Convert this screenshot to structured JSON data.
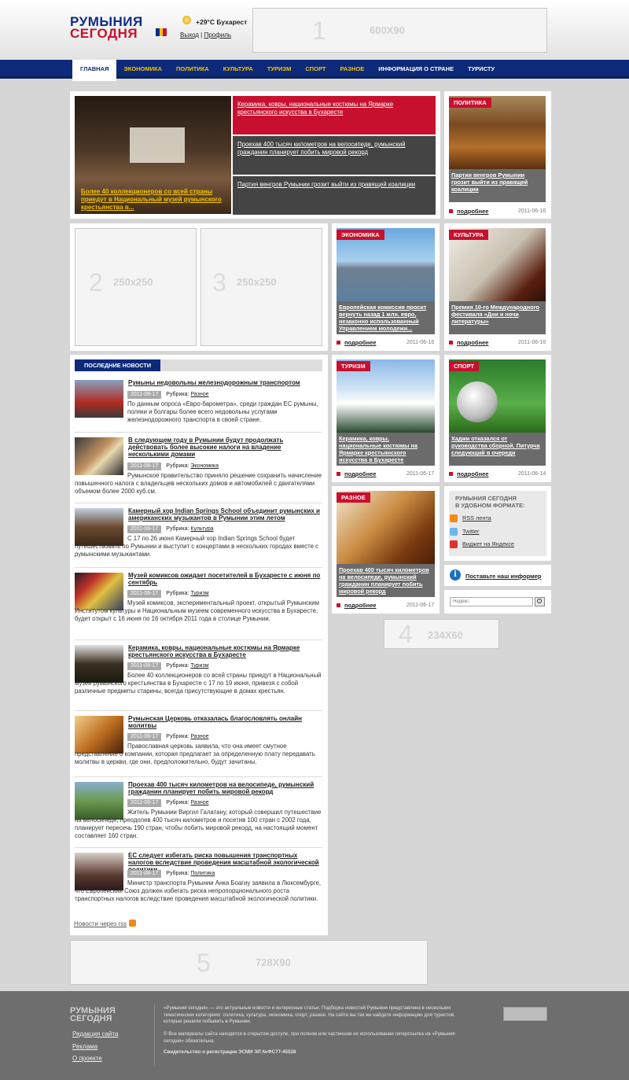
{
  "header": {
    "logo_line1": "РУМЫНИЯ",
    "logo_line2": "СЕГОДНЯ",
    "weather": "+29°C Бухарест",
    "logout": "Выход",
    "auth_sep": "|",
    "profile": "Профиль"
  },
  "banners": {
    "b1": {
      "num": "1",
      "size": "600X90"
    },
    "b2": {
      "num": "2",
      "size": "250x250"
    },
    "b3": {
      "num": "3",
      "size": "250x250"
    },
    "b4": {
      "num": "4",
      "size": "234X60"
    },
    "b5": {
      "num": "5",
      "size": "728X90"
    }
  },
  "nav": [
    "ГЛАВНАЯ",
    "ЭКОНОМИКА",
    "ПОЛИТИКА",
    "КУЛЬТУРА",
    "ТУРИЗМ",
    "СПОРТ",
    "РАЗНОЕ",
    "ИНФОРМАЦИЯ О СТРАНЕ",
    "ТУРИСТУ"
  ],
  "slider": {
    "caption": "Более 40 коллекционеров со всей страны приедут в Национальный музей румынского крестьянства в...",
    "headlines": [
      "Керамика, ковры, национальные костюмы на Ярмарке крестьянского искусства в Бухаресте",
      "Проехав 400 тысяч километров на велосипеде, румынский гражданин планирует побить мировой рекорд",
      "Партия венгров Румынии грозит выйти из правящей коалиции"
    ]
  },
  "cards": [
    {
      "tag": "ПОЛИТИКА",
      "title": "Партия венгров Румынии грозит выйти из правящей коалиции",
      "more": "подробнее",
      "date": "2011-06-16"
    },
    {
      "tag": "ЭКОНОМИКА",
      "title": "Европейская комиссия просит вернуть назад 1 млн. евро, незаконно использованный Управлением молодежи...",
      "more": "подробнее",
      "date": "2011-06-16"
    },
    {
      "tag": "КУЛЬТУРА",
      "title": "Премия 10-го Международного фестиваля «Дни и ночи литературы»",
      "more": "подробнее",
      "date": "2011-06-16"
    },
    {
      "tag": "ТУРИЗМ",
      "title": "Керамика, ковры, национальные костюмы на Ярмарке крестьянского искусства в Бухаресте",
      "more": "подробнее",
      "date": "2011-06-17"
    },
    {
      "tag": "СПОРТ",
      "title": "Хаджи отказался от руководства сборной. Питурча следующий в очереди",
      "more": "подробнее",
      "date": "2011-06-14"
    },
    {
      "tag": "РАЗНОЕ",
      "title": "Проехав 400 тысяч километров на велосипеде, румынский гражданин планирует побить мировой рекорд",
      "more": "подробнее",
      "date": "2011-06-17"
    }
  ],
  "formats": {
    "title1": "РУМЫНИЯ СЕГОДНЯ",
    "title2": "В УДОБНОМ ФОРМАТЕ:",
    "rss": "RSS лента",
    "twitter": "Twitter",
    "yandex": "Виджет на Яндексе",
    "informer": "Поставьте наш информер",
    "search_placeholder": "Яндекс"
  },
  "latest": {
    "title": "ПОСЛЕДНИЕ НОВОСТИ",
    "rubric_label": "Рубрика:",
    "rss_link": "Новости через rss",
    "items": [
      {
        "title": "Румыны недовольны железнодорожным транспортом",
        "date": "2011-06-17",
        "rubric": "Разное",
        "text": "По данным опроса «Евро-барометра», среди граждан ЕС румыны, поляки и болгары более всего недовольны услугами железнодорожного транспорта в своей стране."
      },
      {
        "title": "В следующем году в Румынии будут продолжать действовать более высокие налоги на владение несколькими домами",
        "date": "2011-06-17",
        "rubric": "Экономика",
        "text": "Румынское правительство приняло решение сохранить начисление повышенного налога с владельцев нескольких домов и автомобилей с двигателями объемом более 2000 куб.см."
      },
      {
        "title": "Камерный хор Indian Springs School объединит румынских и американских музыкантов в Румынии этим летом",
        "date": "2011-06-17",
        "rubric": "Культура",
        "text": "С 17 по 26 июня Камерный хор Indian Springs School будет путешествовать по Румынии и выступит с концертами в нескольких городах вместе с румынскими музыкантами."
      },
      {
        "title": "Музей комиксов ожидает посетителей в Бухаресте с июня по сентябрь",
        "date": "2011-06-17",
        "rubric": "Туризм",
        "text": "Музей комиксов, экспериментальный проект, открытый Румынским Институтом культуры и Национальным музеем современного искусства в Бухаресте, будет открыт с 16 июня по 16 октября 2011 года в столице Румынии."
      },
      {
        "title": "Керамика, ковры, национальные костюмы на Ярмарке крестьянского искусства в Бухаресте",
        "date": "2011-06-17",
        "rubric": "Туризм",
        "text": "Более 40 коллекционеров со всей страны приедут в Национальный музей румынского крестьянства в Бухаресте с 17 по 19 июня, привезя с собой различные предметы старины, всегда присутствующие в домах крестьян."
      },
      {
        "title": "Румынская Церковь отказалась благословлять онлайн молитвы",
        "date": "2011-06-17",
        "rubric": "Разное",
        "text": "Православная церковь заявила, что она имеет смутное представление о компании, которая предлагает за определенную плату передавать молитвы в церкви, где они, предположительно, будут зачитаны."
      },
      {
        "title": "Проехав 400 тысяч километров на велосипеде, румынский гражданин планирует побить мировой рекорд",
        "date": "2011-06-17",
        "rubric": "Разное",
        "text": "Житель Румынии Виргил Галатану, который совершил путешествие на велосипеде, преодолев 400 тысяч километров и посетив 100 стран с 2002 года, планирует пересечь 190 стран, чтобы побить мировой рекорд, на настоящий момент составляет 160 стран."
      },
      {
        "title": "ЕС следует избегать риска повышения транспортных налогов вследствие проведения масштабной экологической политики",
        "date": "2011-06-17",
        "rubric": "Политика",
        "text": "Министр транспорта Румынии Анка Боагиу заявила в Люксембурге, что Европейский Союз должен избегать риска непропорционального роста транспортных налогов вследствие проведения масштабной экологической политики."
      }
    ]
  },
  "footer": {
    "logo1": "РУМЫНИЯ",
    "logo2": "СЕГОДНЯ",
    "links": [
      "Редакция сайта",
      "Реклама",
      "О проекте"
    ],
    "text1": "«Румыния сегодня» — это актуальные новости и интересные статьи. Подборка новостей Румынии представлена в нескольких тематических категориях: политика, культура, экономика, спорт, разное. На сайте вы так же найдете информацию для туристов, которые решили побывать в Румынии.",
    "text2": "© Все материалы сайта находятся в открытом доступе, при полном или частичном их использовании гиперссылка на «Румыния сегодня» обязательна.",
    "text3": "Свидетельство о регистрации ЭСМИ ЭЛ №ФС77-45538"
  },
  "colors": {
    "brand_blue": "#0d2a7a",
    "accent_red": "#c8102e",
    "nav_yellow": "#f5c400"
  }
}
